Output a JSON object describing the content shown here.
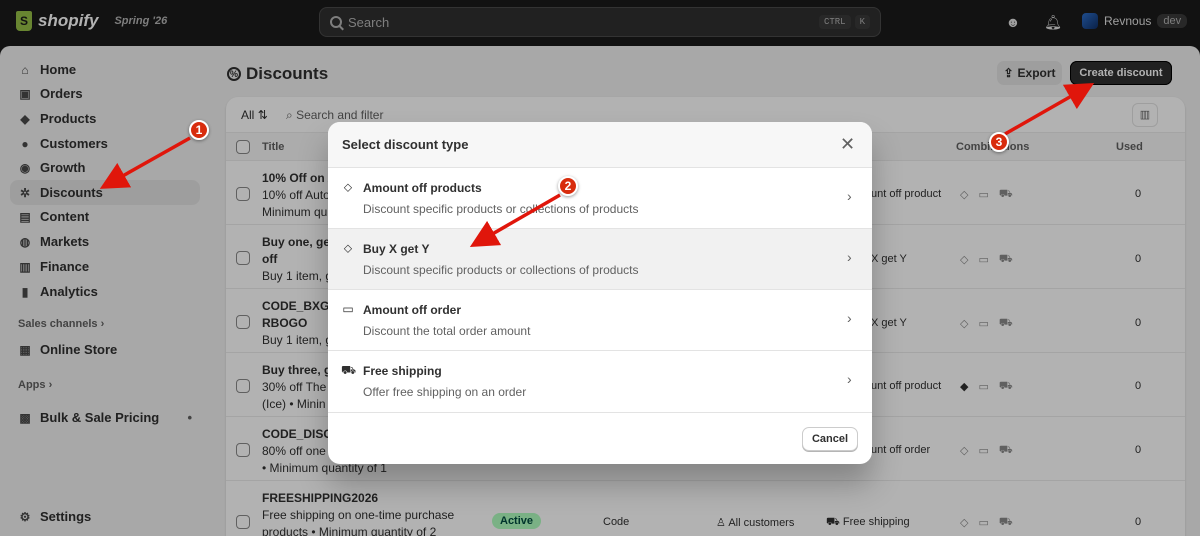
{
  "topbar": {
    "brand": "shopify",
    "edition": "Spring '26",
    "search_placeholder": "Search",
    "shortcut_ctrl": "CTRL",
    "shortcut_key": "K",
    "user_name": "Revnous",
    "user_tag": "dev"
  },
  "sidebar": {
    "items": [
      {
        "label": "Home",
        "icon": "home-icon",
        "glyph": "⌂"
      },
      {
        "label": "Orders",
        "icon": "inbox-icon",
        "glyph": "▣"
      },
      {
        "label": "Products",
        "icon": "tag-icon",
        "glyph": "◆"
      },
      {
        "label": "Customers",
        "icon": "person-icon",
        "glyph": "●"
      },
      {
        "label": "Growth",
        "icon": "growth-icon",
        "glyph": "◉"
      },
      {
        "label": "Discounts",
        "icon": "discount-icon",
        "glyph": "✲"
      },
      {
        "label": "Content",
        "icon": "content-icon",
        "glyph": "▤"
      },
      {
        "label": "Markets",
        "icon": "globe-icon",
        "glyph": "◍"
      },
      {
        "label": "Finance",
        "icon": "bank-icon",
        "glyph": "▥"
      },
      {
        "label": "Analytics",
        "icon": "chart-icon",
        "glyph": "▮"
      }
    ],
    "sales_channels_label": "Sales channels",
    "online_store_label": "Online Store",
    "apps_label": "Apps",
    "bulk_pricing_label": "Bulk & Sale Pricing",
    "settings_label": "Settings",
    "active": "Discounts"
  },
  "page": {
    "title": "Discounts",
    "export_label": "Export",
    "create_label": "Create discount"
  },
  "table": {
    "filter_all": "All",
    "filter_placeholder": "Search and filter",
    "headers": {
      "title": "Title",
      "combinations": "Combinations",
      "used": "Used"
    },
    "rows": [
      {
        "title": "10% Off on A",
        "desc": "10% off Auto",
        "desc2": "Minimum qu",
        "type": "unt off product",
        "used": "0"
      },
      {
        "title": "Buy one, get",
        "desc": "off",
        "desc2": "Buy 1 item, g",
        "type": "X get Y",
        "used": "0"
      },
      {
        "title": "CODE_BXGY",
        "desc": "RBOGO",
        "desc2": "Buy 1 item, g",
        "type": "X get Y",
        "used": "0"
      },
      {
        "title": "Buy three, g",
        "desc": "30% off The",
        "desc2": "(Ice) • Minin",
        "type": "unt off product",
        "used": "0"
      },
      {
        "title": "CODE_DISC",
        "desc": "80% off one",
        "desc2": "• Minimum quantity of 1",
        "type": "unt off order",
        "used": "0"
      },
      {
        "title": "FREESHIPPING2026",
        "desc": "Free shipping on one-time purchase",
        "desc2": "products • Minimum quantity of 2",
        "status": "Active",
        "method": "Code",
        "eligibility": "All customers",
        "type": "Free shipping",
        "used": "0"
      }
    ]
  },
  "modal": {
    "title": "Select discount type",
    "options": [
      {
        "title": "Amount off products",
        "desc": "Discount specific products or collections of products",
        "icon": "tag-icon"
      },
      {
        "title": "Buy X get Y",
        "desc": "Discount specific products or collections of products",
        "icon": "tag-icon"
      },
      {
        "title": "Amount off order",
        "desc": "Discount the total order amount",
        "icon": "cart-icon"
      },
      {
        "title": "Free shipping",
        "desc": "Offer free shipping on an order",
        "icon": "truck-icon"
      }
    ],
    "cancel_label": "Cancel"
  },
  "annotations": {
    "numbers": [
      "1",
      "2",
      "3"
    ],
    "color": "#d82c0d"
  }
}
